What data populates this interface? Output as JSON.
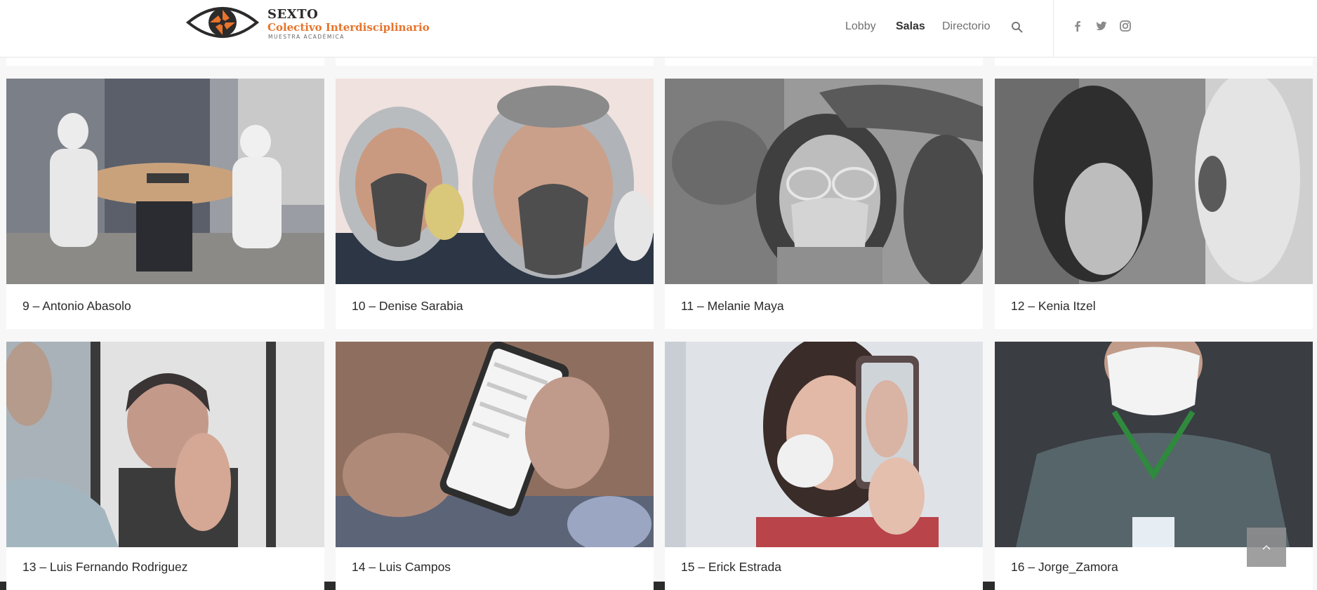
{
  "header": {
    "logo": {
      "line1": "SEXTO",
      "line2": "Colectivo Interdisciplinario",
      "line3": "MUESTRA ACADÉMICA"
    },
    "nav": [
      {
        "label": "Lobby",
        "active": false
      },
      {
        "label": "Salas",
        "active": true
      },
      {
        "label": "Directorio",
        "active": false
      }
    ],
    "icons": {
      "search": "search-icon",
      "social": [
        "facebook-icon",
        "twitter-icon",
        "instagram-icon"
      ]
    }
  },
  "cards": [
    {
      "title": "9 – Antonio Abasolo"
    },
    {
      "title": "10 – Denise Sarabia"
    },
    {
      "title": "11 – Melanie Maya"
    },
    {
      "title": "12 – Kenia Itzel"
    },
    {
      "title": "13 – Luis Fernando Rodriguez"
    },
    {
      "title": "14 – Luis Campos"
    },
    {
      "title": "15 – Erick Estrada"
    },
    {
      "title": "16 – Jorge_Zamora"
    }
  ],
  "scroll_top": {
    "icon": "chevron-up-icon"
  },
  "colors": {
    "accent": "#e8732a",
    "logo_dark": "#2b2b2b"
  }
}
